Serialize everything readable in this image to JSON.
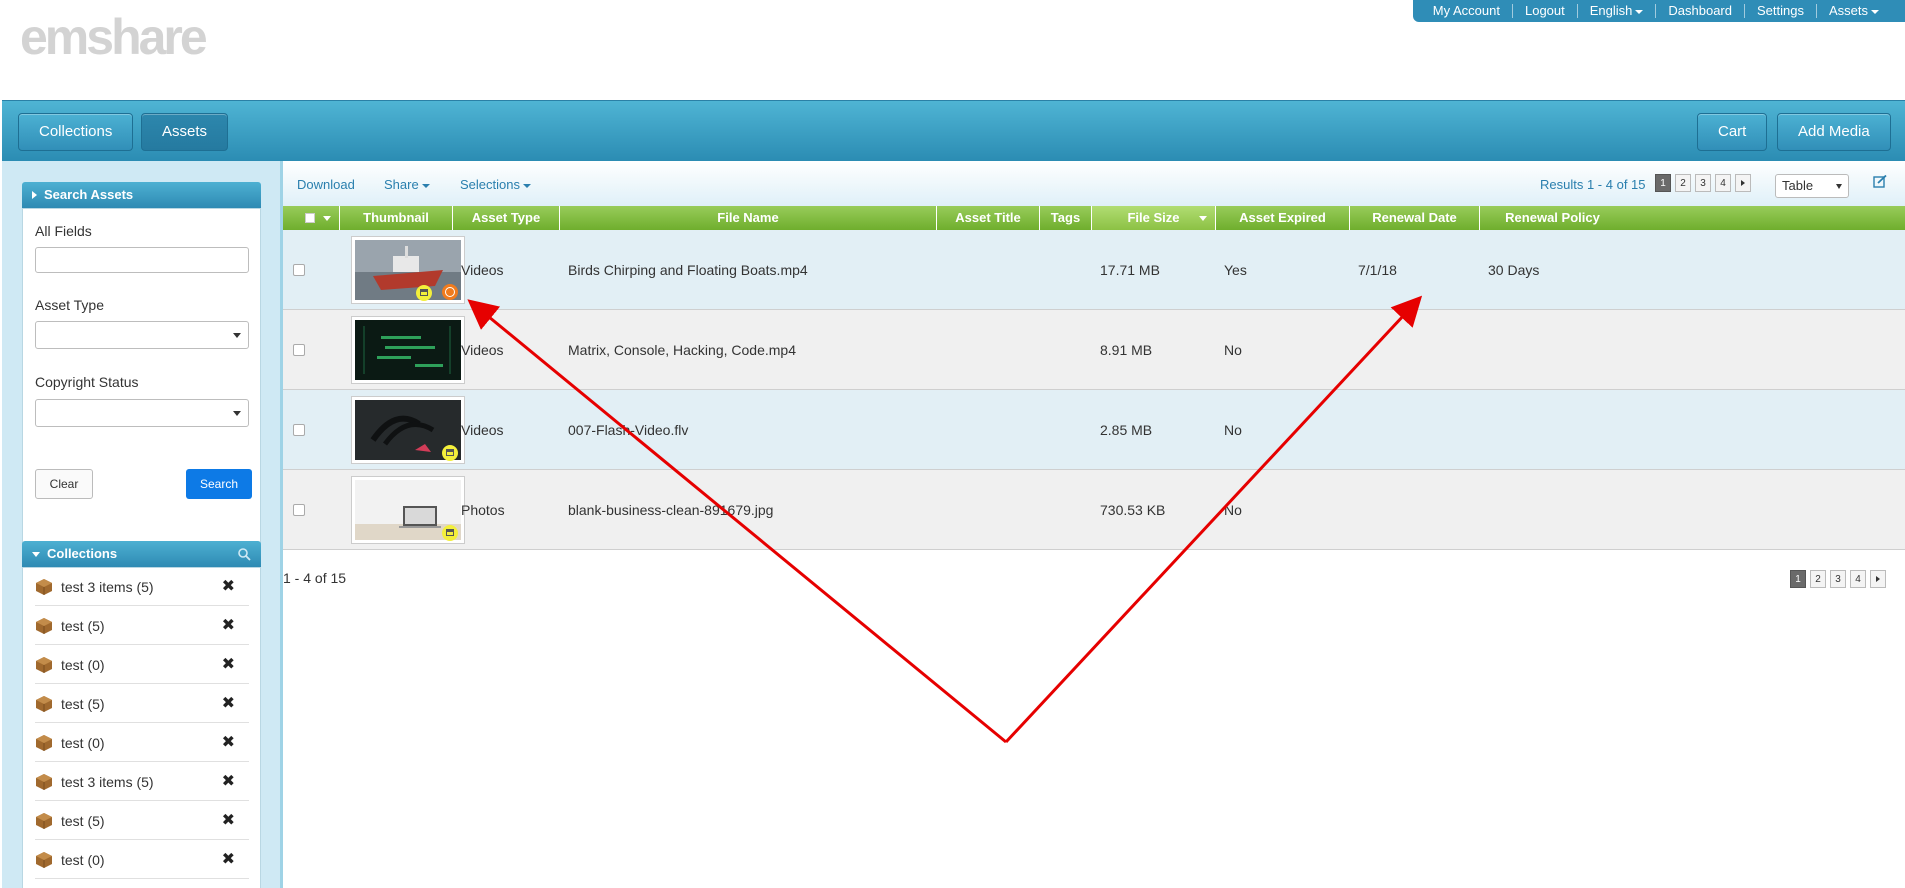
{
  "app": {
    "logo_text": "emshare",
    "top_nav": [
      "My Account",
      "Logout",
      "English",
      "Dashboard",
      "Settings",
      "Assets"
    ]
  },
  "band": {
    "collections_label": "Collections",
    "assets_label": "Assets",
    "cart_label": "Cart",
    "add_media_label": "Add Media"
  },
  "search_panel": {
    "title": "Search Assets",
    "all_fields_label": "All Fields",
    "all_fields_value": "",
    "asset_type_label": "Asset Type",
    "asset_type_value": "",
    "copyright_label": "Copyright Status",
    "copyright_value": "",
    "clear_label": "Clear",
    "search_label": "Search"
  },
  "collections_panel": {
    "title": "Collections",
    "items": [
      {
        "label": "test 3 items (5)"
      },
      {
        "label": "test (5)"
      },
      {
        "label": "test (0)"
      },
      {
        "label": "test (5)"
      },
      {
        "label": "test (0)"
      },
      {
        "label": "test 3 items (5)"
      },
      {
        "label": "test (5)"
      },
      {
        "label": "test (0)"
      }
    ]
  },
  "toolbar": {
    "download_label": "Download",
    "share_label": "Share",
    "selections_label": "Selections",
    "results_text": "Results 1 - 4 of 15",
    "pages": [
      "1",
      "2",
      "3",
      "4"
    ],
    "current_page": "1",
    "view_mode": "Table"
  },
  "table": {
    "columns": [
      "Thumbnail",
      "Asset Type",
      "File Name",
      "Asset Title",
      "Tags",
      "File Size",
      "Asset Expired",
      "Renewal Date",
      "Renewal Policy"
    ],
    "sorted_column": "File Size",
    "rows": [
      {
        "asset_type": "Videos",
        "file_name": "Birds Chirping and Floating Boats.mp4",
        "asset_title": "",
        "tags": "",
        "file_size": "17.71 MB",
        "expired": "Yes",
        "renewal_date": "7/1/18",
        "renewal_policy": "30 Days",
        "thumb": "boat",
        "badges": [
          "license",
          "clock"
        ]
      },
      {
        "asset_type": "Videos",
        "file_name": "Matrix, Console, Hacking, Code.mp4",
        "asset_title": "",
        "tags": "",
        "file_size": "8.91 MB",
        "expired": "No",
        "renewal_date": "",
        "renewal_policy": "",
        "thumb": "matrix",
        "badges": []
      },
      {
        "asset_type": "Videos",
        "file_name": "007-Flash-Video.flv",
        "asset_title": "",
        "tags": "",
        "file_size": "2.85 MB",
        "expired": "No",
        "renewal_date": "",
        "renewal_policy": "",
        "thumb": "dark",
        "badges": [
          "license"
        ]
      },
      {
        "asset_type": "Photos",
        "file_name": "blank-business-clean-891679.jpg",
        "asset_title": "",
        "tags": "",
        "file_size": "730.53 KB",
        "expired": "No",
        "renewal_date": "",
        "renewal_policy": "",
        "thumb": "laptop",
        "badges": [
          "license"
        ]
      }
    ]
  },
  "footer": {
    "count_text": "1 - 4 of 15",
    "pages": [
      "1",
      "2",
      "3",
      "4"
    ]
  },
  "colors": {
    "brand_blue": "#2f8db7",
    "header_green": "#7db83e",
    "annotation_red": "#e60000"
  }
}
